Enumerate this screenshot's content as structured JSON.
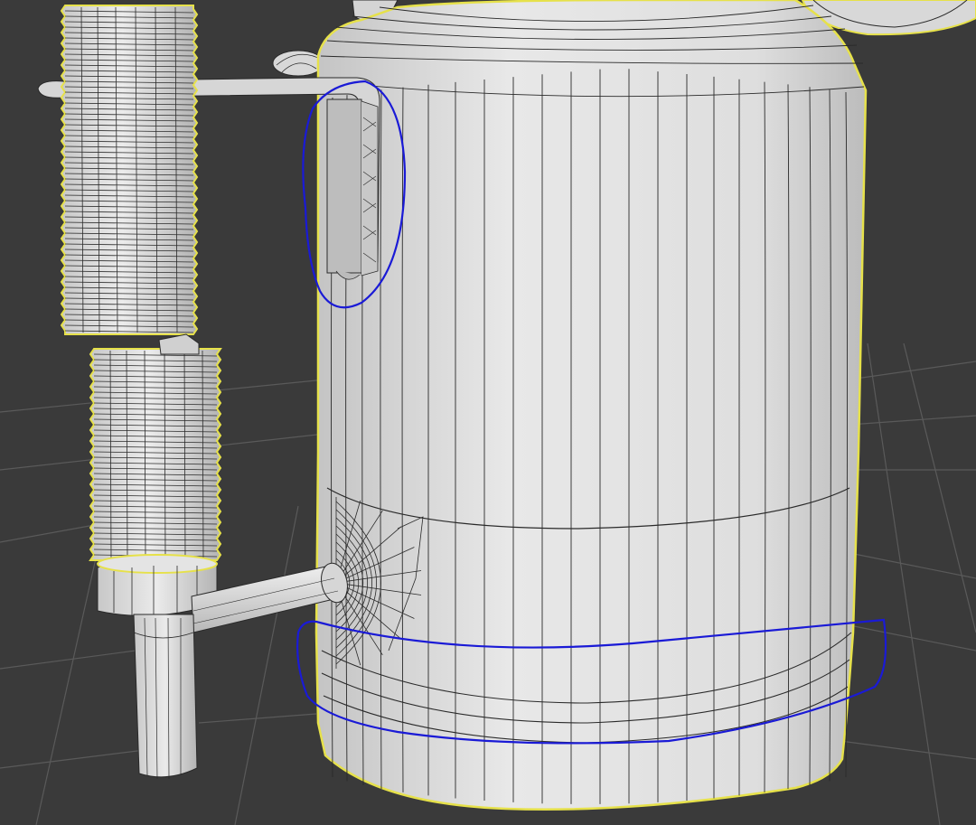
{
  "viewport": {
    "background": "#3a3a3a",
    "grid_color": "#5a5a5a",
    "selection_color": "#e6e14a",
    "annotation_color": "#1a1ad6",
    "wire_color": "#2a2a2a",
    "mesh_fill": "#dcdcdc"
  },
  "scene": {
    "objects": [
      {
        "name": "tank",
        "icon": "cylinder-tank",
        "selected": true
      },
      {
        "name": "ribbed-hose",
        "icon": "ribbed-hose",
        "selected": true
      },
      {
        "name": "handle-bracket",
        "icon": "bracket",
        "selected": false
      },
      {
        "name": "side-pipe",
        "icon": "pipe",
        "selected": false
      }
    ],
    "annotations": [
      {
        "name": "bracket-loop",
        "icon": "freehand-loop"
      },
      {
        "name": "base-band-loop",
        "icon": "freehand-loop"
      }
    ]
  }
}
